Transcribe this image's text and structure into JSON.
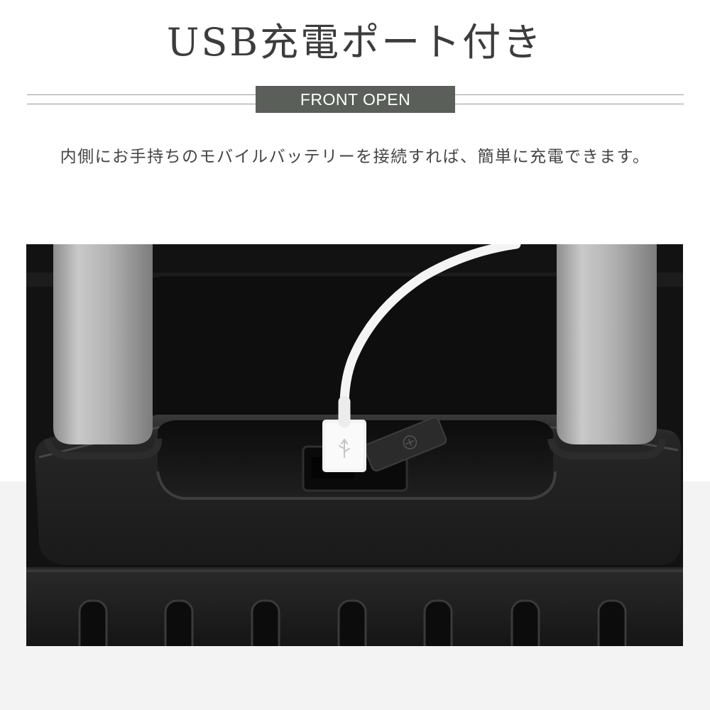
{
  "header": {
    "title": "USB充電ポート付き",
    "badge": "FRONT OPEN"
  },
  "description": "内側にお手持ちのモバイルバッテリーを接続すれば、簡単に充電できます。",
  "colors": {
    "badge_background": "#5a5f5a",
    "title_text": "#3c3c3c",
    "body_text": "#444444",
    "photo_dark": "#141414",
    "handle_silver": "#b8b8b8",
    "cable_white": "#ffffff"
  },
  "photo": {
    "subject": "suitcase-front-usb-port",
    "icons": [
      "usb-icon",
      "airplane-icon"
    ]
  }
}
